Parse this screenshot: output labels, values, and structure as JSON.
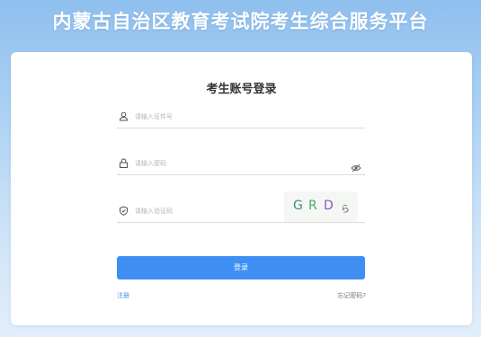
{
  "header": {
    "title": "内蒙古自治区教育考试院考生综合服务平台"
  },
  "login": {
    "title": "考生账号登录",
    "id_field": {
      "placeholder": "请输入证件号",
      "icon": "user-icon"
    },
    "password_field": {
      "placeholder": "请输入密码",
      "icon": "lock-icon",
      "toggle_icon": "eye-icon"
    },
    "captcha_field": {
      "placeholder": "请输入验证码",
      "icon": "shield-icon"
    },
    "captcha_image": {
      "chars": [
        "G",
        "R",
        "D",
        "ら"
      ]
    },
    "login_button": "登录",
    "register_link": "注册",
    "forgot_link": "忘记密码?"
  },
  "colors": {
    "accent": "#3f8ff2",
    "header_bg": "#8fbfee",
    "captcha_chars": [
      "#3e8c7e",
      "#4aa86a",
      "#8a56b8",
      "#5c5c5c"
    ]
  }
}
